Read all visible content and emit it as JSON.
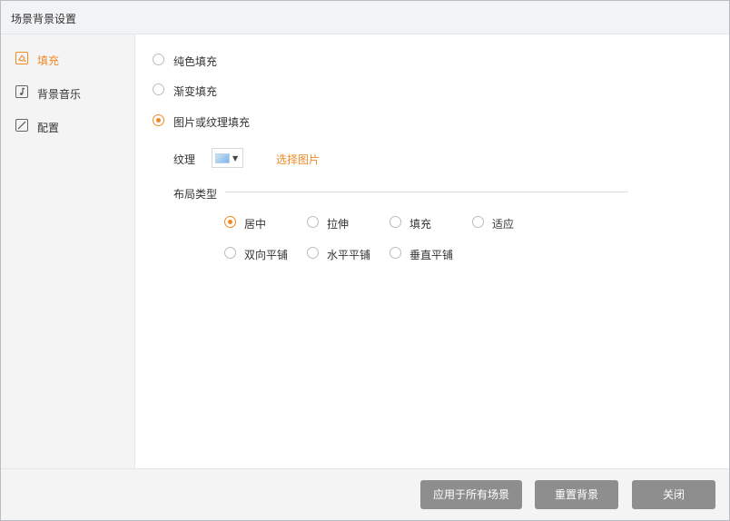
{
  "dialog": {
    "title": "场景背景设置"
  },
  "sidebar": {
    "items": [
      {
        "label": "填充",
        "icon": "fill-icon",
        "active": true
      },
      {
        "label": "背景音乐",
        "icon": "music-icon",
        "active": false
      },
      {
        "label": "配置",
        "icon": "config-icon",
        "active": false
      }
    ]
  },
  "fill_options": {
    "selected": "图片或纹理填充",
    "items": [
      "纯色填充",
      "渐变填充",
      "图片或纹理填充"
    ]
  },
  "texture": {
    "label": "纹理",
    "choose_link": "选择图片"
  },
  "layout": {
    "title": "布局类型",
    "selected": "居中",
    "options_row1": [
      "居中",
      "拉伸",
      "填充",
      "适应"
    ],
    "options_row2": [
      "双向平铺",
      "水平平铺",
      "垂直平铺"
    ]
  },
  "footer": {
    "apply_all_label": "应用于所有场景",
    "reset_label": "重置背景",
    "close_label": "关闭"
  },
  "colors": {
    "accent": "#f08a24",
    "button_bg": "#8e8e8e"
  }
}
